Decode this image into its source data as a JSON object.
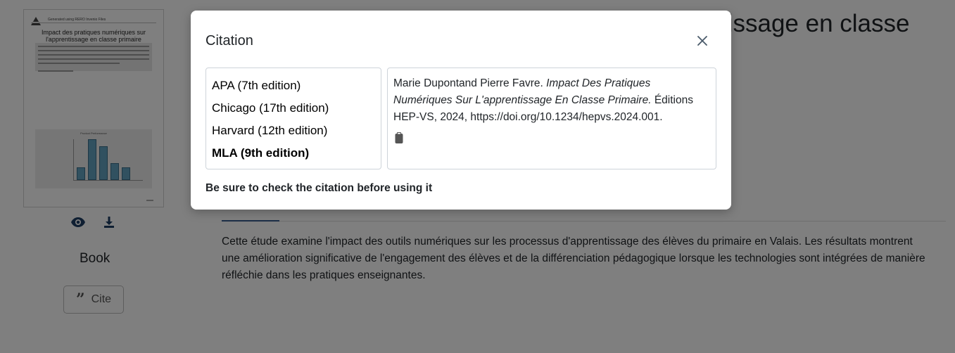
{
  "thumbnail": {
    "generated_by": "Generated using RERO Invenio Files",
    "title": "Impact des pratiques numériques sur l'apprentissage en classe primaire",
    "chart_title": "Product Performance"
  },
  "actions": {
    "view_icon": "eye-icon",
    "download_icon": "download-icon"
  },
  "doc_type": "Book",
  "cite_button": {
    "label": "Cite",
    "icon": "quote-icon"
  },
  "background": {
    "heading_fragment": "tissage en classe",
    "abstract": "Cette étude examine l'impact des outils numériques sur les processus d'apprentissage des élèves du primaire en Valais. Les résultats montrent une amélioration significative de l'engagement des élèves et de la différenciation pédagogique lorsque les technologies sont intégrées de manière réfléchie dans les pratiques enseignantes."
  },
  "modal": {
    "title": "Citation",
    "close_icon": "close-icon",
    "styles": [
      {
        "label": "APA (7th edition)",
        "selected": false
      },
      {
        "label": "Chicago (17th edition)",
        "selected": false
      },
      {
        "label": "Harvard (12th edition)",
        "selected": false
      },
      {
        "label": "MLA (9th edition)",
        "selected": true
      }
    ],
    "citation": {
      "authors": "Marie Dupontand Pierre Favre.",
      "title_italic": "Impact Des Pratiques Numériques Sur L'apprentissage En Classe Primaire.",
      "rest": "Éditions HEP-VS, 2024, https://doi.org/10.1234/hepvs.2024.001."
    },
    "copy_icon": "clipboard-icon",
    "note": "Be sure to check the citation before using it"
  },
  "colors": {
    "accent": "#3a5f8f",
    "bar": "#63a3c0"
  }
}
